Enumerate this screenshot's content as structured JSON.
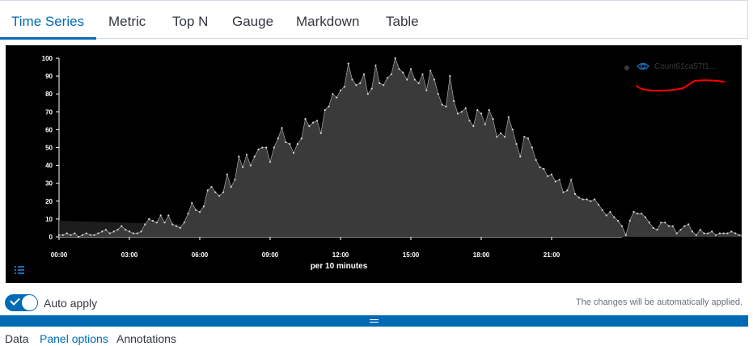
{
  "tabs": [
    {
      "label": "Time Series",
      "active": true
    },
    {
      "label": "Metric",
      "active": false
    },
    {
      "label": "Top N",
      "active": false
    },
    {
      "label": "Gauge",
      "active": false
    },
    {
      "label": "Markdown",
      "active": false
    },
    {
      "label": "Table",
      "active": false
    }
  ],
  "chart": {
    "legend_series_name": "Count61ca57f1...",
    "icons": {
      "legend_visibility": "eye-icon",
      "legend_toggle": "list-icon"
    },
    "colors": {
      "background": "#000000",
      "series": "#ffffff",
      "area": "#3a3a3a",
      "annotation": "#ff0000"
    }
  },
  "chart_data": {
    "type": "area",
    "xlabel": "per 10 minutes",
    "ylabel": "",
    "x_ticks": [
      "00:00",
      "03:00",
      "06:00",
      "09:00",
      "12:00",
      "15:00",
      "18:00",
      "21:00"
    ],
    "y_ticks": [
      0,
      10,
      20,
      30,
      40,
      50,
      60,
      70,
      80,
      90,
      100
    ],
    "ylim": [
      0,
      100
    ],
    "interval_minutes": 10,
    "series": [
      {
        "name": "Count61ca57f1...",
        "values": [
          1,
          1,
          2,
          1,
          2,
          0,
          1,
          2,
          1,
          1,
          2,
          3,
          4,
          2,
          3,
          4,
          6,
          4,
          3,
          2,
          2,
          3,
          7,
          10,
          9,
          8,
          12,
          8,
          12,
          7,
          6,
          5,
          8,
          13,
          19,
          15,
          14,
          17,
          26,
          28,
          25,
          23,
          25,
          35,
          28,
          32,
          45,
          39,
          46,
          40,
          45,
          49,
          50,
          50,
          42,
          50,
          55,
          61,
          53,
          52,
          47,
          52,
          55,
          66,
          62,
          64,
          65,
          58,
          71,
          73,
          80,
          78,
          82,
          84,
          97,
          88,
          85,
          86,
          91,
          80,
          83,
          96,
          86,
          85,
          89,
          91,
          100,
          94,
          92,
          88,
          94,
          88,
          86,
          91,
          82,
          93,
          88,
          80,
          74,
          73,
          90,
          76,
          69,
          70,
          72,
          65,
          62,
          71,
          69,
          63,
          71,
          66,
          56,
          58,
          56,
          67,
          60,
          52,
          45,
          56,
          55,
          50,
          43,
          39,
          38,
          34,
          35,
          31,
          32,
          25,
          26,
          32,
          24,
          22,
          21,
          21,
          20,
          21,
          18,
          15,
          12,
          14,
          11,
          9,
          6,
          1,
          9,
          14,
          13,
          13,
          11,
          8,
          5,
          4,
          8,
          8,
          6,
          6,
          2,
          4,
          6,
          7,
          3,
          1,
          4,
          2,
          2,
          3,
          1,
          2,
          2,
          2,
          3,
          2,
          1,
          1
        ]
      }
    ],
    "grid": false,
    "legend_position": "top-right"
  },
  "autoapply": {
    "label": "Auto apply",
    "on": true,
    "note": "The changes will be automatically applied."
  },
  "bottom_tabs": [
    {
      "label": "Data",
      "active": false
    },
    {
      "label": "Panel options",
      "active": true
    },
    {
      "label": "Annotations",
      "active": false
    }
  ]
}
